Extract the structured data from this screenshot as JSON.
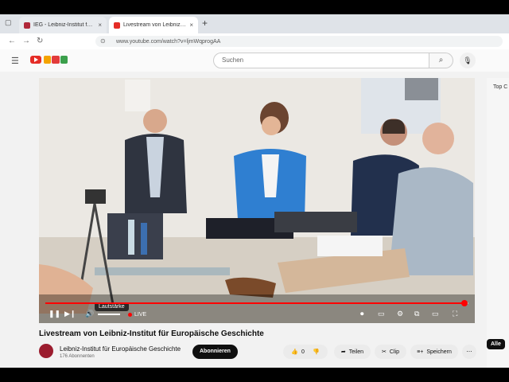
{
  "browser": {
    "tabs": [
      {
        "label": "IEG - Leibniz-Institut für Europäi",
        "favicon_color": "#b0283a"
      },
      {
        "label": "Livestream von Leibniz-Inst",
        "favicon_color": "#e52d27"
      }
    ],
    "url": "www.youtube.com/watch?v=ljmWqprogAA"
  },
  "youtube": {
    "search_placeholder": "Suchen",
    "video_title": "Livestream von Leibniz-Institut für Europäische Geschichte",
    "channel_name": "Leibniz-Institut für Europäische Geschichte",
    "subscribers": "176 Abonnenten",
    "subscribe_label": "Abonnieren",
    "like_count": "0",
    "share_label": "Teilen",
    "clip_label": "Clip",
    "save_label": "Speichern",
    "sidebar_label": "Top C",
    "filter_chip": "Alle",
    "player": {
      "tooltip": "Lautstärke",
      "live_label": "LIVE",
      "progress": 0.99
    }
  }
}
